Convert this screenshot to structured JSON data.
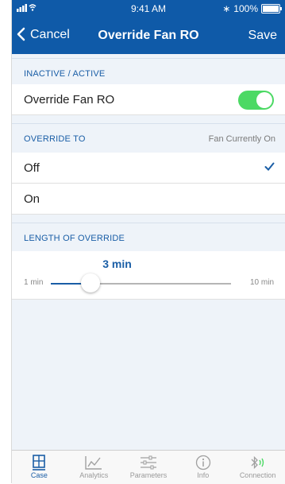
{
  "status": {
    "time": "9:41 AM",
    "battery": "100%"
  },
  "nav": {
    "cancel_label": "Cancel",
    "title": "Override Fan RO",
    "save_label": "Save"
  },
  "sections": {
    "inactive_active": {
      "label": "INACTIVE / ACTIVE"
    },
    "override_to": {
      "label": "OVERRIDE TO",
      "status": "Fan Currently On"
    },
    "length": {
      "label": "LENGTH OF OVERRIDE"
    }
  },
  "toggle_row": {
    "label": "Override Fan RO",
    "enabled": true
  },
  "options": [
    {
      "label": "Off",
      "selected": true
    },
    {
      "label": "On",
      "selected": false
    }
  ],
  "slider": {
    "value_label": "3 min",
    "min_label": "1 min",
    "max_label": "10 min",
    "value": 3,
    "min": 1,
    "max": 10
  },
  "tabs": [
    {
      "label": "Case",
      "icon": "case-icon",
      "active": true
    },
    {
      "label": "Analytics",
      "icon": "analytics-icon",
      "active": false
    },
    {
      "label": "Parameters",
      "icon": "parameters-icon",
      "active": false
    },
    {
      "label": "Info",
      "icon": "info-icon",
      "active": false
    },
    {
      "label": "Connection",
      "icon": "bluetooth-icon",
      "active": false
    }
  ],
  "colors": {
    "brand": "#0f5aa8",
    "accent": "#1a5ea6",
    "toggle_on": "#4cd964"
  }
}
